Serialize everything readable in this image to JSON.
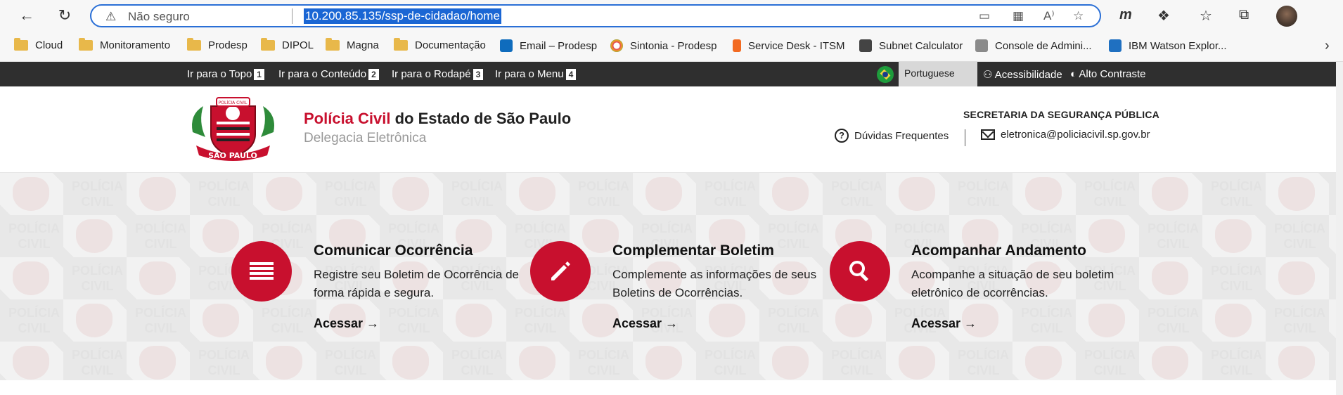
{
  "browser": {
    "insecure_label": "Não seguro",
    "url": "10.200.85.135/ssp-de-cidadao/home",
    "bookmarks": [
      {
        "label": "Cloud",
        "icon": "folder-icon"
      },
      {
        "label": "Monitoramento",
        "icon": "folder-icon"
      },
      {
        "label": "Prodesp",
        "icon": "folder-icon"
      },
      {
        "label": "DIPOL",
        "icon": "folder-icon"
      },
      {
        "label": "Magna",
        "icon": "folder-icon"
      },
      {
        "label": "Documentação",
        "icon": "folder-icon"
      },
      {
        "label": "Email – Prodesp",
        "icon": "outlook-icon"
      },
      {
        "label": "Sintonia - Prodesp",
        "icon": "sintonia-icon"
      },
      {
        "label": "Service Desk - ITSM",
        "icon": "servicedesk-icon"
      },
      {
        "label": "Subnet Calculator",
        "icon": "calculator-icon"
      },
      {
        "label": "Console de Admini...",
        "icon": "console-icon"
      },
      {
        "label": "IBM Watson Explor...",
        "icon": "ibm-icon"
      }
    ]
  },
  "topbar": {
    "skip_links": [
      {
        "label": "Ir para o Topo",
        "num": "1"
      },
      {
        "label": "Ir para o Conteúdo",
        "num": "2"
      },
      {
        "label": "Ir para o Rodapé",
        "num": "3"
      },
      {
        "label": "Ir para o Menu",
        "num": "4"
      }
    ],
    "language": "Portuguese",
    "accessibility": "Acessibilidade",
    "high_contrast": "Alto Contraste"
  },
  "header": {
    "title_red": "Polícia Civil",
    "title_rest": " do Estado de São Paulo",
    "subtitle": "Delegacia Eletrônica",
    "secretaria": "SECRETARIA DA SEGURANÇA PÚBLICA",
    "faq": "Dúvidas Frequentes",
    "email": "eletronica@policiacivil.sp.gov.br",
    "logo_text_top": "POLÍCIA CIVIL",
    "logo_text_bottom": "SÃO PAULO"
  },
  "hero": {
    "watermark_line1": "POLÍCIA",
    "watermark_line2": "CIVIL"
  },
  "cards": [
    {
      "title": "Comunicar Ocorrência",
      "desc": "Registre seu Boletim de Ocorrência de forma rápida e segura.",
      "link": "Acessar →",
      "icon": "list-icon"
    },
    {
      "title": "Complementar Boletim",
      "desc": "Complemente as informações de seus Boletins de Ocorrências.",
      "link": "Acessar →",
      "icon": "pencil-icon"
    },
    {
      "title": "Acompanhar Andamento",
      "desc": "Acompanhe a situação de seu boletim eletrônico de ocorrências.",
      "link": "Acessar →",
      "icon": "search-icon"
    }
  ],
  "colors": {
    "brand_red": "#c8102e",
    "topbar_dark": "#2f2f2f",
    "url_highlight": "#1a66d4"
  }
}
